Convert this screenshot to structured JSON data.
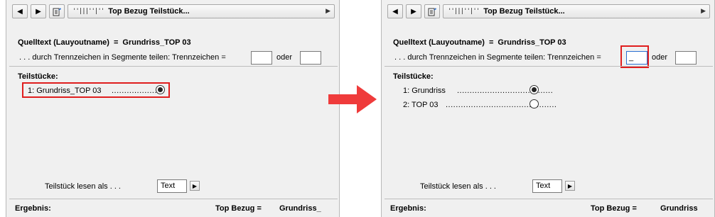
{
  "left_panel": {
    "title": "Top Bezug Teilstück...",
    "source_label": "Quelltext (Lauyoutname)",
    "source_eq": "=",
    "source_value": "Grundriss_TOP 03",
    "segment_label": ". . . durch Trennzeichen in Segmente teilen:  Trennzeichen =",
    "separator1_value": "",
    "or_label": "oder",
    "separator2_value": "",
    "pieces_title": "Teilstücke:",
    "pieces": [
      {
        "text": "1:  Grundriss_TOP 03",
        "dots": "....................",
        "selected": true
      }
    ],
    "read_as_label": "Teilstück lesen als . . .",
    "read_as_value": "Text",
    "result_label": "Ergebnis:",
    "result_ref": "Top Bezug  =",
    "result_value": "Grundriss_"
  },
  "right_panel": {
    "title": "Top Bezug Teilstück...",
    "source_label": "Quelltext (Lauyoutname)",
    "source_eq": "=",
    "source_value": "Grundriss_TOP 03",
    "segment_label": ". . . durch Trennzeichen in Segmente teilen:  Trennzeichen =",
    "separator1_value": "_",
    "or_label": "oder",
    "separator2_value": "",
    "pieces_title": "Teilstücke:",
    "pieces": [
      {
        "text": "1:  Grundriss",
        "dots": "......................................",
        "selected": true
      },
      {
        "text": "2:  TOP 03",
        "dots": "............................................",
        "selected": false
      }
    ],
    "read_as_label": "Teilstück lesen als . . .",
    "read_as_value": "Text",
    "result_label": "Ergebnis:",
    "result_ref": "Top Bezug  =",
    "result_value": "Grundriss"
  },
  "toolbar_glyphs": {
    "prev": "◀",
    "next": "▶",
    "ruler": "''|||''|''",
    "dropdown": "▶"
  },
  "highlight_color": "#e01e1e",
  "arrow_color": "#ef3b3b"
}
